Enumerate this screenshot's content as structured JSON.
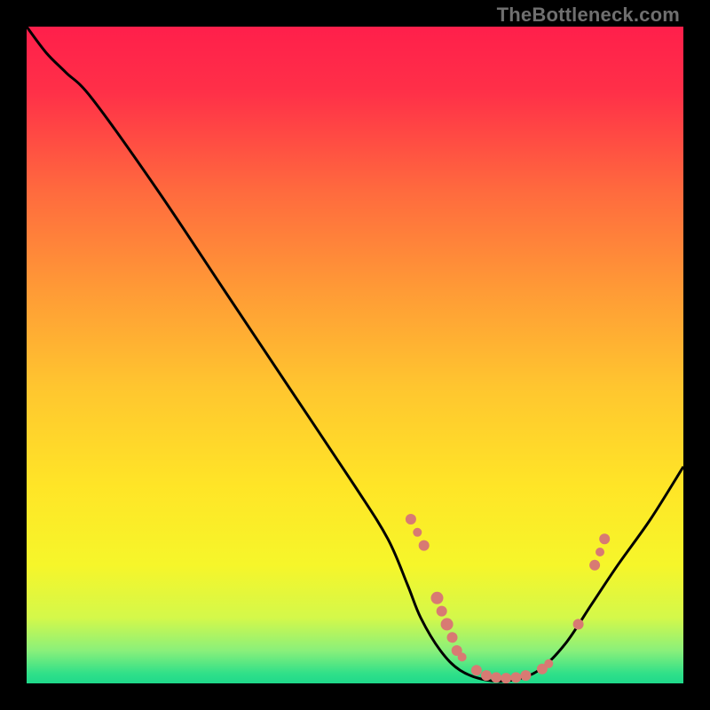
{
  "watermark": "TheBottleneck.com",
  "chart_data": {
    "type": "line",
    "title": "",
    "xlabel": "",
    "ylabel": "",
    "xlim": [
      0,
      100
    ],
    "ylim": [
      0,
      100
    ],
    "grid": false,
    "legend": false,
    "curve": [
      {
        "x": 0,
        "y": 100
      },
      {
        "x": 3,
        "y": 96
      },
      {
        "x": 6,
        "y": 93
      },
      {
        "x": 10,
        "y": 89
      },
      {
        "x": 20,
        "y": 75
      },
      {
        "x": 30,
        "y": 60
      },
      {
        "x": 40,
        "y": 45
      },
      {
        "x": 50,
        "y": 30
      },
      {
        "x": 55,
        "y": 22
      },
      {
        "x": 58,
        "y": 15
      },
      {
        "x": 60,
        "y": 10
      },
      {
        "x": 63,
        "y": 5
      },
      {
        "x": 66,
        "y": 2
      },
      {
        "x": 70,
        "y": 0.5
      },
      {
        "x": 74,
        "y": 0.5
      },
      {
        "x": 78,
        "y": 2
      },
      {
        "x": 82,
        "y": 6
      },
      {
        "x": 86,
        "y": 12
      },
      {
        "x": 90,
        "y": 18
      },
      {
        "x": 95,
        "y": 25
      },
      {
        "x": 100,
        "y": 33
      }
    ],
    "markers": [
      {
        "x": 58.5,
        "y": 25,
        "r": 6
      },
      {
        "x": 59.5,
        "y": 23,
        "r": 5
      },
      {
        "x": 60.5,
        "y": 21,
        "r": 6
      },
      {
        "x": 62.5,
        "y": 13,
        "r": 7
      },
      {
        "x": 63.2,
        "y": 11,
        "r": 6
      },
      {
        "x": 64.0,
        "y": 9,
        "r": 7
      },
      {
        "x": 64.8,
        "y": 7,
        "r": 6
      },
      {
        "x": 65.5,
        "y": 5,
        "r": 6
      },
      {
        "x": 66.3,
        "y": 4,
        "r": 5
      },
      {
        "x": 68.5,
        "y": 2,
        "r": 6
      },
      {
        "x": 70.0,
        "y": 1.2,
        "r": 6
      },
      {
        "x": 71.5,
        "y": 0.9,
        "r": 6
      },
      {
        "x": 73.0,
        "y": 0.8,
        "r": 6
      },
      {
        "x": 74.5,
        "y": 0.9,
        "r": 6
      },
      {
        "x": 76.0,
        "y": 1.2,
        "r": 6
      },
      {
        "x": 78.5,
        "y": 2.2,
        "r": 6
      },
      {
        "x": 79.5,
        "y": 3,
        "r": 5
      },
      {
        "x": 84.0,
        "y": 9,
        "r": 6
      },
      {
        "x": 86.5,
        "y": 18,
        "r": 6
      },
      {
        "x": 87.3,
        "y": 20,
        "r": 5
      },
      {
        "x": 88.0,
        "y": 22,
        "r": 6
      }
    ],
    "gradient_stops": [
      {
        "offset": 0.0,
        "color": "#ff1f4b"
      },
      {
        "offset": 0.1,
        "color": "#ff3048"
      },
      {
        "offset": 0.25,
        "color": "#ff6a3e"
      },
      {
        "offset": 0.4,
        "color": "#ff9a36"
      },
      {
        "offset": 0.55,
        "color": "#ffc62f"
      },
      {
        "offset": 0.7,
        "color": "#ffe527"
      },
      {
        "offset": 0.82,
        "color": "#f6f62a"
      },
      {
        "offset": 0.9,
        "color": "#d4f84a"
      },
      {
        "offset": 0.95,
        "color": "#8af07a"
      },
      {
        "offset": 0.985,
        "color": "#30e089"
      },
      {
        "offset": 1.0,
        "color": "#1fd98a"
      }
    ],
    "marker_color": "#d87a73",
    "curve_color": "#000000"
  }
}
